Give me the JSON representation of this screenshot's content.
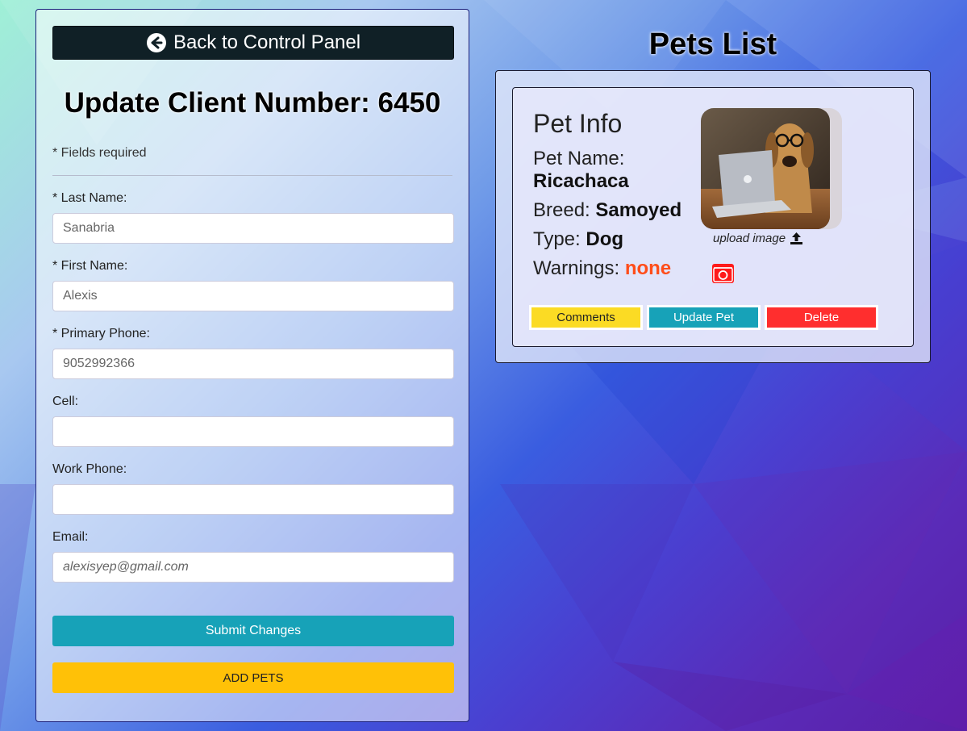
{
  "left": {
    "back_button_label": "Back to Control Panel",
    "title": "Update Client Number: 6450",
    "required_note": "* Fields required",
    "fields": [
      {
        "label": "* Last Name:",
        "value": "",
        "placeholder": "Sanabria"
      },
      {
        "label": "* First Name:",
        "value": "",
        "placeholder": "Alexis"
      },
      {
        "label": "* Primary Phone:",
        "value": "",
        "placeholder": "9052992366"
      },
      {
        "label": "Cell:",
        "value": "",
        "placeholder": ""
      },
      {
        "label": "Work Phone:",
        "value": "",
        "placeholder": ""
      },
      {
        "label": "Email:",
        "value": "",
        "placeholder": "alexisyep@gmail.com"
      }
    ],
    "submit_label": "Submit Changes",
    "add_pets_label": "ADD PETS"
  },
  "right": {
    "title": "Pets List",
    "pet": {
      "heading": "Pet Info",
      "name_label": "Pet Name:",
      "name": "Ricachaca",
      "breed_label": "Breed:",
      "breed": "Samoyed",
      "type_label": "Type:",
      "type": "Dog",
      "warnings_label": "Warnings:",
      "warnings": "none",
      "upload_label": "upload image",
      "comments_label": "Comments",
      "update_label": "Update Pet",
      "delete_label": "Delete"
    }
  },
  "colors": {
    "back_button": "#102026",
    "submit": "#17a2b8",
    "add_pets": "#ffc107",
    "comments": "#fbdb24",
    "update": "#17a2b8",
    "delete": "#ff2e2e",
    "warning_value": "#ff4d1a"
  },
  "icons": {
    "back": "arrow-left-circle-icon",
    "upload": "upload-icon",
    "camera": "camera-icon"
  }
}
